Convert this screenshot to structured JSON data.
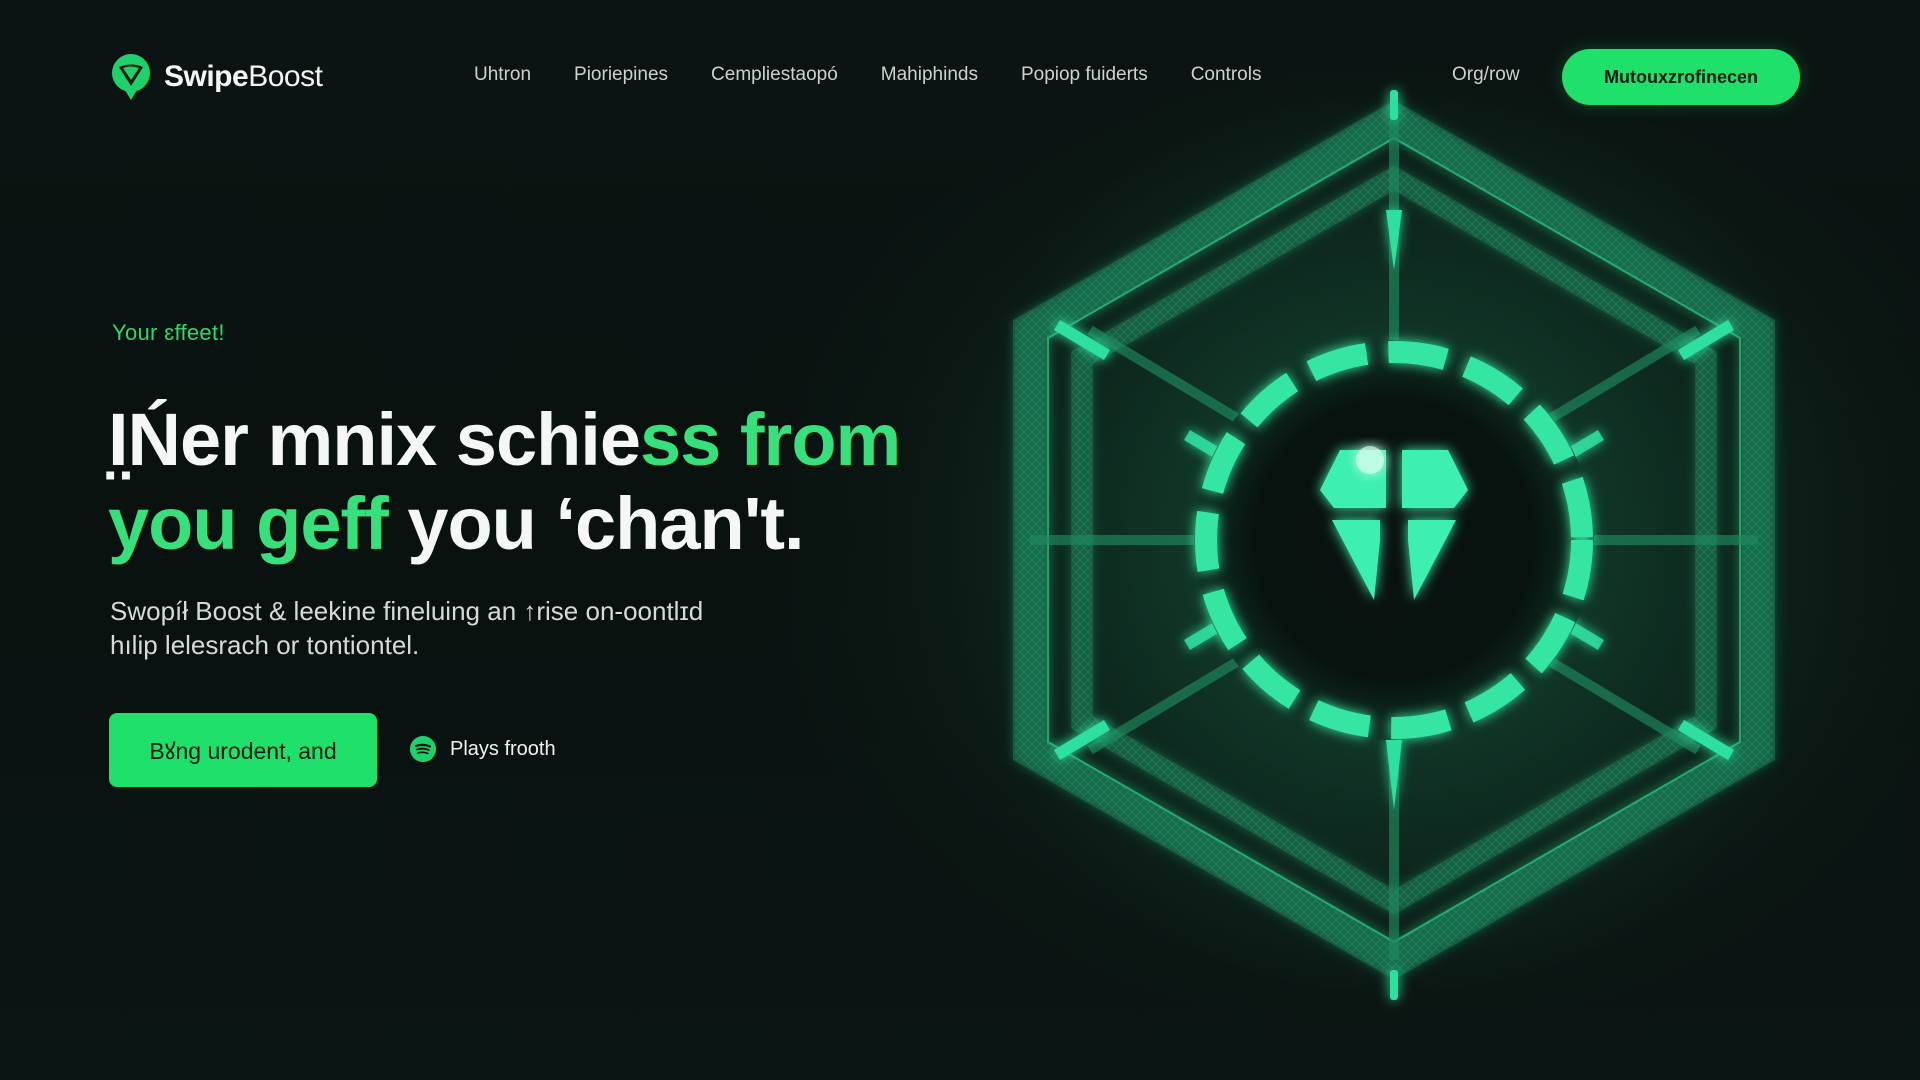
{
  "brand": {
    "name_bold": "Swipe",
    "name_thin": "Boost",
    "logo_icon": "heart-pin-logo"
  },
  "nav": {
    "links": [
      "Uhtron",
      "Pioriepines",
      "Cempliestaopó",
      "Mahiphinds",
      "Popiop fuiderts",
      "Controls"
    ],
    "signin": "Org/row",
    "cta_label": "Mutouxzrofinecen"
  },
  "hero": {
    "eyebrow": "Your ɛffeet!",
    "headline": {
      "part1": "I̤Ńer mnix schie",
      "part2_green": "ss from",
      "part3_green": "you geff",
      "part4": " you ‘chan't."
    },
    "subtext_line1": "Swopíł Boost & leekine fineluing an ↑rise on-oontlɪd",
    "subtext_line2": "hılip lelesrach or tontiontel.",
    "primary_button": "Bꙋng urodent, and",
    "secondary_link": "Plays frooth",
    "secondary_icon": "spotify-icon"
  },
  "colors": {
    "accent": "#1fe06a",
    "headline_green": "#37e07a",
    "background": "#0a1210"
  }
}
